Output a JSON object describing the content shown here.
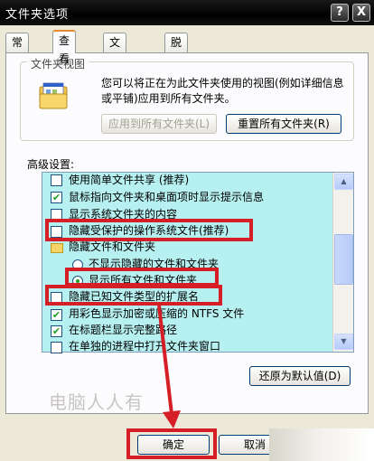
{
  "window": {
    "title": "文件夹选项",
    "help_label": "?",
    "close_label": "X"
  },
  "tabs": [
    {
      "label": "常规"
    },
    {
      "label": "查看"
    },
    {
      "label": "文件类型"
    },
    {
      "label": "脱机文件"
    }
  ],
  "folder_views": {
    "group_label": "文件夹视图",
    "description": "您可以将正在为此文件夹使用的视图(例如详细信息或平铺)应用到所有文件夹。",
    "apply_all_label": "应用到所有文件夹(L)",
    "reset_all_label": "重置所有文件夹(R)"
  },
  "advanced": {
    "label": "高级设置:",
    "items": [
      {
        "label": "使用简单文件共享 (推荐)",
        "type": "checkbox",
        "checked": false
      },
      {
        "label": "鼠标指向文件夹和桌面项时显示提示信息",
        "type": "checkbox",
        "checked": true
      },
      {
        "label": "显示系统文件夹的内容",
        "type": "checkbox",
        "checked": false
      },
      {
        "label": "隐藏受保护的操作系统文件(推荐)",
        "type": "checkbox",
        "checked": false
      },
      {
        "label": "隐藏文件和文件夹",
        "type": "folder"
      },
      {
        "label": "不显示隐藏的文件和文件夹",
        "type": "radio",
        "checked": false
      },
      {
        "label": "显示所有文件和文件夹",
        "type": "radio",
        "checked": true
      },
      {
        "label": "隐藏已知文件类型的扩展名",
        "type": "checkbox",
        "checked": false
      },
      {
        "label": "用彩色显示加密或压缩的 NTFS 文件",
        "type": "checkbox",
        "checked": true
      },
      {
        "label": "在标题栏显示完整路径",
        "type": "checkbox",
        "checked": true
      },
      {
        "label": "在单独的进程中打开文件夹窗口",
        "type": "checkbox",
        "checked": false
      }
    ],
    "restore_defaults_label": "还原为默认值(D)"
  },
  "watermark": "电脑人人有",
  "footer": {
    "ok_label": "确定",
    "cancel_label": "取消"
  },
  "colors": {
    "highlight": "#d61e26",
    "tree_bg": "#b7f0f0",
    "title_bg": "#000000"
  }
}
